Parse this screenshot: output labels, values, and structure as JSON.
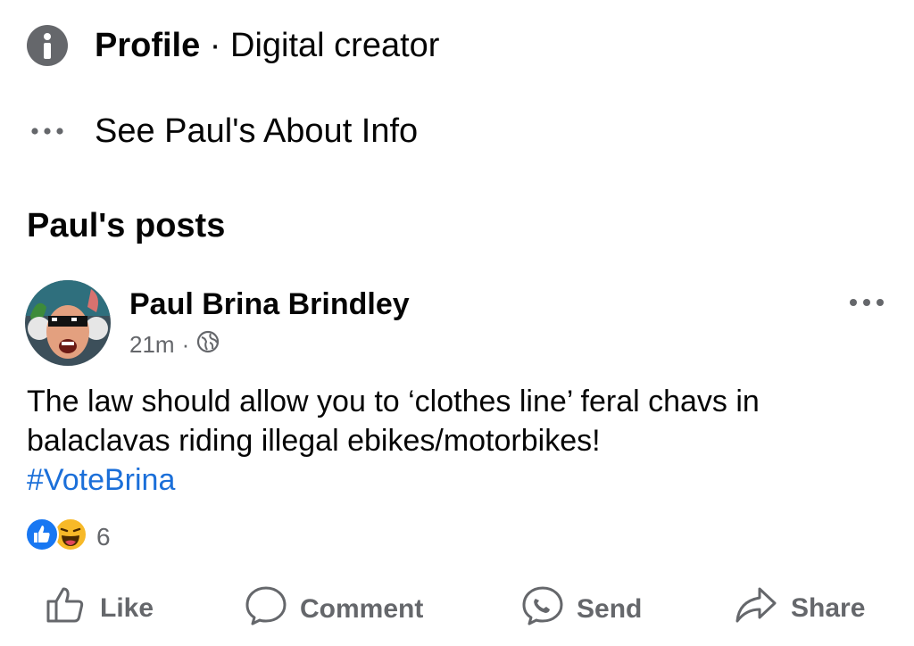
{
  "profile_info": {
    "label": "Profile",
    "separator": " · ",
    "category": "Digital creator"
  },
  "about": {
    "label": "See Paul's About Info"
  },
  "section": {
    "title": "Paul's posts"
  },
  "post": {
    "author": "Paul Brina Brindley",
    "time": "21m",
    "meta_separator": "·",
    "audience_icon": "globe-icon",
    "text": "The law should allow you to ‘clothes line’ feral chavs in balaclavas riding illegal ebikes/motorbikes!",
    "hashtag": "#VoteBrina",
    "reaction_icons": [
      "like-reaction-icon",
      "haha-reaction-icon"
    ],
    "reaction_count": "6"
  },
  "actions": [
    {
      "label": "Like",
      "icon": "thumbs-up-icon"
    },
    {
      "label": "Comment",
      "icon": "comment-icon"
    },
    {
      "label": "Send",
      "icon": "messenger-icon"
    },
    {
      "label": "Share",
      "icon": "share-icon"
    }
  ],
  "colors": {
    "link": "#1b6fd9",
    "secondary_text": "#65676b",
    "like_blue": "#1877f2",
    "haha_yellow": "#f7b928"
  }
}
